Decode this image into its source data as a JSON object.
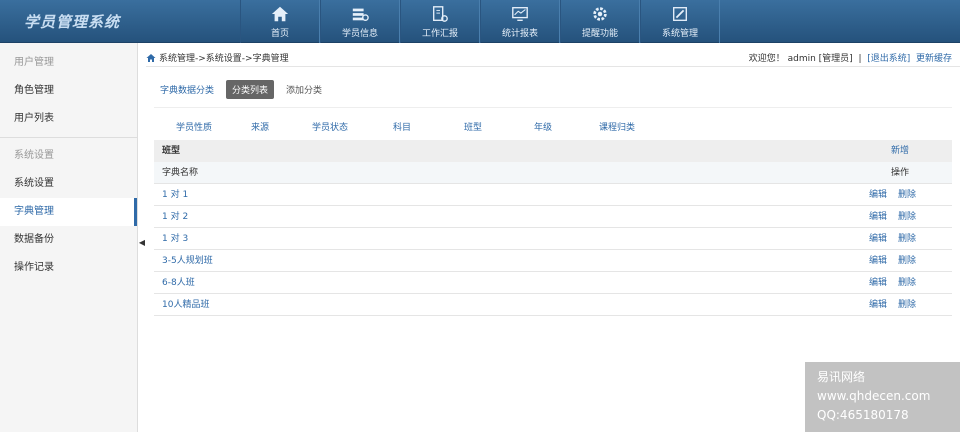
{
  "header": {
    "brand": "学员管理系统",
    "nav": [
      {
        "label": "首页",
        "icon": "home-icon"
      },
      {
        "label": "学员信息",
        "icon": "students-icon"
      },
      {
        "label": "工作汇报",
        "icon": "report-icon"
      },
      {
        "label": "统计报表",
        "icon": "stats-icon"
      },
      {
        "label": "提醒功能",
        "icon": "gear-icon"
      },
      {
        "label": "系统管理",
        "icon": "settings-icon"
      }
    ]
  },
  "sidebar": {
    "group1": "用户管理",
    "items1": [
      "角色管理",
      "用户列表"
    ],
    "group2": "系统设置",
    "items2": [
      "系统设置",
      "字典管理",
      "数据备份",
      "操作记录"
    ]
  },
  "breadcrumb": "系统管理->系统设置->字典管理",
  "userbar": {
    "welcome": "欢迎您！ admin [管理员]",
    "sep": "|",
    "logout": "[退出系统]",
    "refresh": "更新缓存"
  },
  "tabs": {
    "main": "字典数据分类",
    "list": "分类列表",
    "add": "添加分类"
  },
  "categories": [
    "学员性质",
    "来源",
    "学员状态",
    "科目",
    "班型",
    "年级",
    "课程归类"
  ],
  "table": {
    "title": "班型",
    "add": "新增",
    "col_name": "字典名称",
    "col_op": "操作",
    "edit": "编辑",
    "delete": "删除",
    "rows": [
      "1 对 1",
      "1 对 2",
      "1 对 3",
      "3-5人规划班",
      "6-8人班",
      "10人精品班"
    ]
  },
  "watermark": {
    "line1": "易讯网络",
    "line2": "www.qhdecen.com",
    "line3": "QQ:465180178"
  }
}
